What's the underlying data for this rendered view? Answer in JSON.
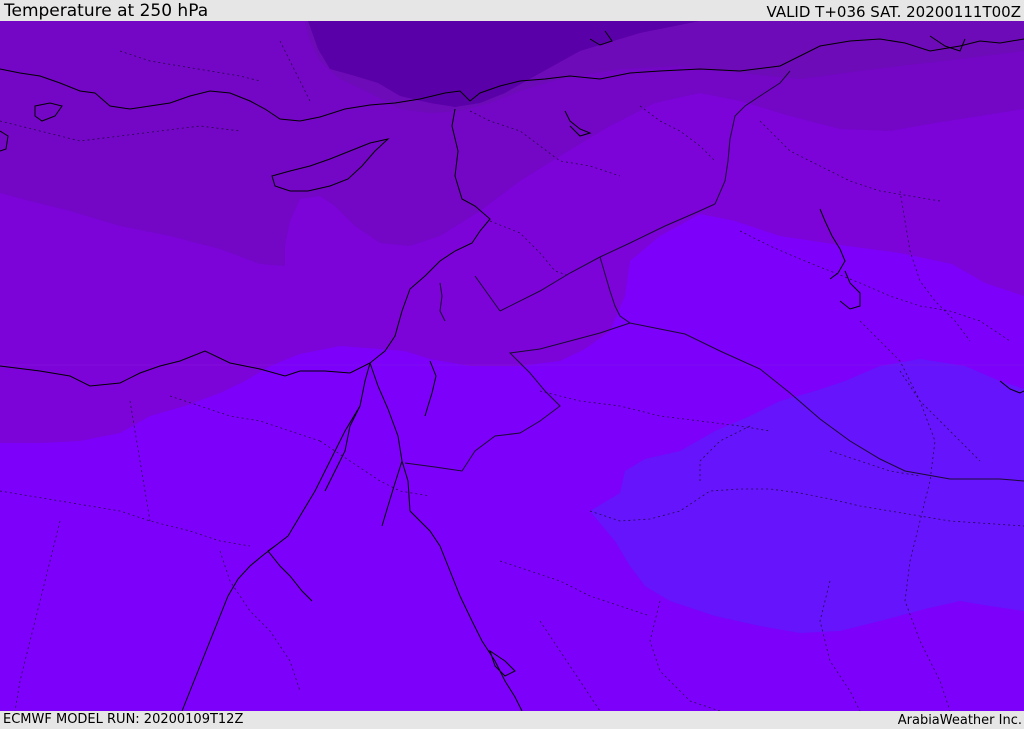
{
  "header": {
    "title": "Temperature at 250 hPa",
    "valid": "VALID T+036 SAT. 20200111T00Z"
  },
  "footer": {
    "model_run": "ECMWF MODEL RUN: 20200109T12Z",
    "credit": "ArabiaWeather Inc."
  },
  "colors": {
    "band_darkest": "#5a00a8",
    "band_dark": "#6e0bb8",
    "band_mid_dark": "#7406c6",
    "band_mid": "#7c04d8",
    "band_bright": "#7d00fa",
    "band_cool": "#6514fb",
    "coastline": "#000000",
    "border": "#1a0b33"
  }
}
